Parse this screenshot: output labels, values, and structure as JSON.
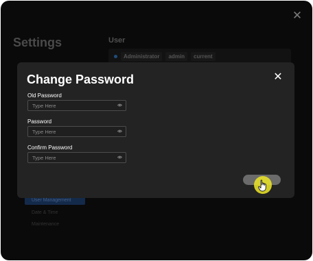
{
  "settings": {
    "title": "Settings",
    "section_heading": "User",
    "user_row": {
      "name": "Administrator",
      "role": "admin",
      "status": "current"
    },
    "sidebar_items": [
      {
        "label": "User Management",
        "active": true
      },
      {
        "label": "Date & Time",
        "active": false
      },
      {
        "label": "Maintenance",
        "active": false
      }
    ]
  },
  "dialog": {
    "title": "Change Password",
    "fields": [
      {
        "label": "Old Password",
        "value": "",
        "placeholder": "Type Here",
        "icon": "eye-icon"
      },
      {
        "label": "Password",
        "value": "",
        "placeholder": "Type Here",
        "icon": "eye-icon"
      },
      {
        "label": "Confirm Password",
        "value": "",
        "placeholder": "Type Here",
        "icon": "eye-icon"
      }
    ],
    "close_icon": "close-icon",
    "confirm_button_label": "",
    "confirm_button_enabled": false
  },
  "cursor": {
    "icon": "hand-pointer-icon",
    "highlight_color": "#e9e228"
  }
}
